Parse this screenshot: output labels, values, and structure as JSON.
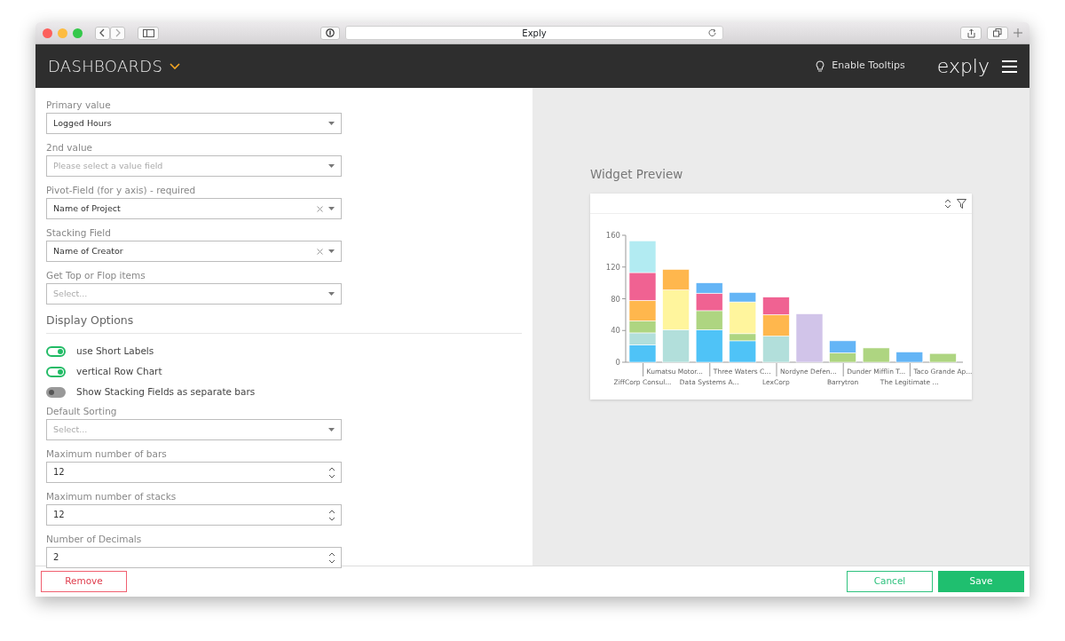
{
  "browser": {
    "title": "Exply"
  },
  "header": {
    "title": "DASHBOARDS",
    "tooltips": "Enable Tooltips",
    "logo": "exply"
  },
  "settings": [
    {
      "kind": "select",
      "label": "Primary value",
      "value": "Logged Hours",
      "clearable": false
    },
    {
      "kind": "select",
      "label": "2nd value",
      "placeholder": "Please select a value field",
      "clearable": false
    },
    {
      "kind": "select",
      "label": "Pivot-Field (for y axis) - required",
      "value": "Name of Project",
      "clearable": true
    },
    {
      "kind": "select",
      "label": "Stacking Field",
      "value": "Name of Creator",
      "clearable": true
    },
    {
      "kind": "select",
      "label": "Get Top or Flop items",
      "placeholder": "Select...",
      "clearable": false
    },
    {
      "kind": "heading",
      "label": "Display Options"
    },
    {
      "kind": "toggle",
      "label": "use Short Labels",
      "on": true
    },
    {
      "kind": "toggle",
      "label": "vertical Row Chart",
      "on": true
    },
    {
      "kind": "toggle",
      "label": "Show Stacking Fields as separate bars",
      "on": false
    },
    {
      "kind": "select",
      "label": "Default Sorting",
      "placeholder": "Select...",
      "clearable": false
    },
    {
      "kind": "number",
      "label": "Maximum number of bars",
      "value": "12"
    },
    {
      "kind": "number",
      "label": "Maximum number of stacks",
      "value": "12"
    },
    {
      "kind": "number",
      "label": "Number of Decimals",
      "value": "2"
    }
  ],
  "preview": {
    "title": "Widget Preview",
    "chart_data": {
      "type": "bar",
      "stacked": true,
      "orientation": "vertical",
      "categories": [
        "ZiffCorp Consul...",
        "Kumatsu Motor...",
        "Data Systems A...",
        "Three Waters C...",
        "LexCorp",
        "Nordyne Defen...",
        "Barrytron",
        "Dunder Mifflin T...",
        "The Legitimate ...",
        "Taco Grande Ap..."
      ],
      "ylim": [
        0,
        160
      ],
      "yticks": [
        0,
        40,
        80,
        120,
        160
      ],
      "series": [
        {
          "color": "#4fc3f7",
          "values": [
            22,
            null,
            41,
            27,
            null,
            null,
            null,
            null,
            null,
            null
          ]
        },
        {
          "color": "#b2dfdb",
          "values": [
            15,
            41,
            null,
            null,
            33,
            null,
            null,
            null,
            null,
            null
          ]
        },
        {
          "color": "#aed581",
          "values": [
            15,
            null,
            24,
            9,
            null,
            null,
            12,
            18,
            null,
            11
          ]
        },
        {
          "color": "#fff59d",
          "values": [
            null,
            50,
            null,
            40,
            null,
            null,
            null,
            null,
            null,
            null
          ]
        },
        {
          "color": "#ffb74d",
          "values": [
            26,
            26,
            null,
            null,
            27,
            null,
            null,
            null,
            null,
            null
          ]
        },
        {
          "color": "#f06292",
          "values": [
            35,
            null,
            22,
            null,
            22,
            null,
            null,
            null,
            null,
            null
          ]
        },
        {
          "color": "#b2ebf2",
          "values": [
            40,
            null,
            null,
            null,
            null,
            null,
            null,
            null,
            null,
            null
          ]
        },
        {
          "color": "#64b5f6",
          "values": [
            null,
            null,
            13,
            12,
            null,
            null,
            15,
            null,
            13,
            null
          ]
        },
        {
          "color": "#d1c4e9",
          "values": [
            null,
            null,
            null,
            null,
            null,
            61,
            null,
            null,
            null,
            null
          ]
        }
      ]
    }
  },
  "footer": [
    {
      "label": "Remove",
      "kind": "danger"
    },
    {
      "label": "Cancel",
      "kind": "outline"
    },
    {
      "label": "Save",
      "kind": "primary"
    }
  ]
}
